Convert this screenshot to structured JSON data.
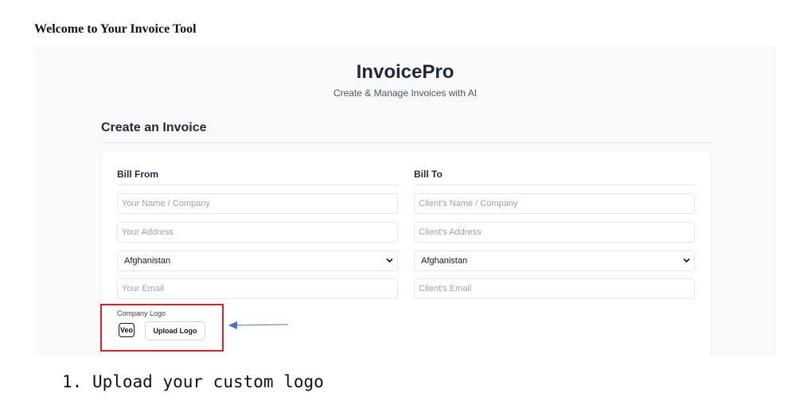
{
  "page_heading": "Welcome to Your Invoice Tool",
  "app": {
    "title": "InvoicePro",
    "tagline": "Create & Manage Invoices with AI",
    "section_title": "Create an Invoice",
    "bill_from": {
      "title": "Bill From",
      "name_placeholder": "Your Name / Company",
      "address_placeholder": "Your Address",
      "country": "Afghanistan",
      "email_placeholder": "Your Email"
    },
    "bill_to": {
      "title": "Bill To",
      "name_placeholder": "Client's Name / Company",
      "address_placeholder": "Client's Address",
      "country": "Afghanistan",
      "email_placeholder": "Client's Email"
    },
    "logo": {
      "label": "Company Logo",
      "preview_text": "Veo",
      "upload_label": "Upload Logo"
    }
  },
  "annotation": {
    "highlight_color": "#e01f26",
    "arrow_color": "#4472c4",
    "caption_number": "1.",
    "caption_text": "Upload your custom logo"
  }
}
